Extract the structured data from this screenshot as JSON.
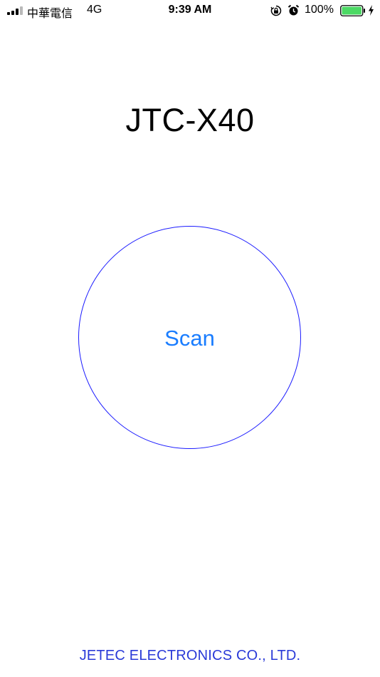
{
  "status_bar": {
    "carrier": "中華電信",
    "network": "4G",
    "time": "9:39 AM",
    "battery_percent": "100%",
    "icons": [
      "signal-icon",
      "orientation-lock-icon",
      "alarm-icon",
      "battery-icon",
      "charging-icon"
    ],
    "battery_level": 1.0,
    "battery_color": "#4cd964",
    "signal_bars_active": 3,
    "signal_bars_total": 4
  },
  "header": {
    "title": "JTC-X40"
  },
  "main": {
    "scan_button_label": "Scan",
    "scan_label_color": "#1a7dff",
    "circle_color": "#1a1aff"
  },
  "footer": {
    "company": "JETEC ELECTRONICS CO., LTD.",
    "color": "#2a3ad8"
  }
}
